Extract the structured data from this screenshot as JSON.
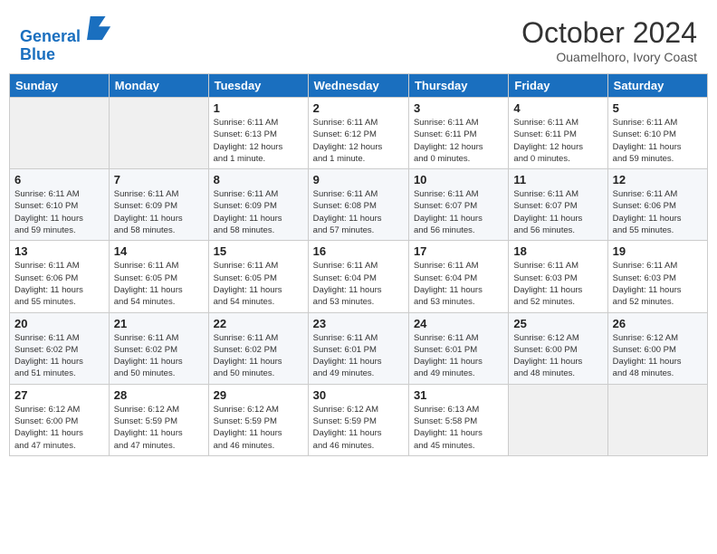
{
  "header": {
    "logo_line1": "General",
    "logo_line2": "Blue",
    "month_title": "October 2024",
    "subtitle": "Ouamelhoro, Ivory Coast"
  },
  "weekdays": [
    "Sunday",
    "Monday",
    "Tuesday",
    "Wednesday",
    "Thursday",
    "Friday",
    "Saturday"
  ],
  "weeks": [
    [
      {
        "day": "",
        "info": ""
      },
      {
        "day": "",
        "info": ""
      },
      {
        "day": "1",
        "info": "Sunrise: 6:11 AM\nSunset: 6:13 PM\nDaylight: 12 hours\nand 1 minute."
      },
      {
        "day": "2",
        "info": "Sunrise: 6:11 AM\nSunset: 6:12 PM\nDaylight: 12 hours\nand 1 minute."
      },
      {
        "day": "3",
        "info": "Sunrise: 6:11 AM\nSunset: 6:11 PM\nDaylight: 12 hours\nand 0 minutes."
      },
      {
        "day": "4",
        "info": "Sunrise: 6:11 AM\nSunset: 6:11 PM\nDaylight: 12 hours\nand 0 minutes."
      },
      {
        "day": "5",
        "info": "Sunrise: 6:11 AM\nSunset: 6:10 PM\nDaylight: 11 hours\nand 59 minutes."
      }
    ],
    [
      {
        "day": "6",
        "info": "Sunrise: 6:11 AM\nSunset: 6:10 PM\nDaylight: 11 hours\nand 59 minutes."
      },
      {
        "day": "7",
        "info": "Sunrise: 6:11 AM\nSunset: 6:09 PM\nDaylight: 11 hours\nand 58 minutes."
      },
      {
        "day": "8",
        "info": "Sunrise: 6:11 AM\nSunset: 6:09 PM\nDaylight: 11 hours\nand 58 minutes."
      },
      {
        "day": "9",
        "info": "Sunrise: 6:11 AM\nSunset: 6:08 PM\nDaylight: 11 hours\nand 57 minutes."
      },
      {
        "day": "10",
        "info": "Sunrise: 6:11 AM\nSunset: 6:07 PM\nDaylight: 11 hours\nand 56 minutes."
      },
      {
        "day": "11",
        "info": "Sunrise: 6:11 AM\nSunset: 6:07 PM\nDaylight: 11 hours\nand 56 minutes."
      },
      {
        "day": "12",
        "info": "Sunrise: 6:11 AM\nSunset: 6:06 PM\nDaylight: 11 hours\nand 55 minutes."
      }
    ],
    [
      {
        "day": "13",
        "info": "Sunrise: 6:11 AM\nSunset: 6:06 PM\nDaylight: 11 hours\nand 55 minutes."
      },
      {
        "day": "14",
        "info": "Sunrise: 6:11 AM\nSunset: 6:05 PM\nDaylight: 11 hours\nand 54 minutes."
      },
      {
        "day": "15",
        "info": "Sunrise: 6:11 AM\nSunset: 6:05 PM\nDaylight: 11 hours\nand 54 minutes."
      },
      {
        "day": "16",
        "info": "Sunrise: 6:11 AM\nSunset: 6:04 PM\nDaylight: 11 hours\nand 53 minutes."
      },
      {
        "day": "17",
        "info": "Sunrise: 6:11 AM\nSunset: 6:04 PM\nDaylight: 11 hours\nand 53 minutes."
      },
      {
        "day": "18",
        "info": "Sunrise: 6:11 AM\nSunset: 6:03 PM\nDaylight: 11 hours\nand 52 minutes."
      },
      {
        "day": "19",
        "info": "Sunrise: 6:11 AM\nSunset: 6:03 PM\nDaylight: 11 hours\nand 52 minutes."
      }
    ],
    [
      {
        "day": "20",
        "info": "Sunrise: 6:11 AM\nSunset: 6:02 PM\nDaylight: 11 hours\nand 51 minutes."
      },
      {
        "day": "21",
        "info": "Sunrise: 6:11 AM\nSunset: 6:02 PM\nDaylight: 11 hours\nand 50 minutes."
      },
      {
        "day": "22",
        "info": "Sunrise: 6:11 AM\nSunset: 6:02 PM\nDaylight: 11 hours\nand 50 minutes."
      },
      {
        "day": "23",
        "info": "Sunrise: 6:11 AM\nSunset: 6:01 PM\nDaylight: 11 hours\nand 49 minutes."
      },
      {
        "day": "24",
        "info": "Sunrise: 6:11 AM\nSunset: 6:01 PM\nDaylight: 11 hours\nand 49 minutes."
      },
      {
        "day": "25",
        "info": "Sunrise: 6:12 AM\nSunset: 6:00 PM\nDaylight: 11 hours\nand 48 minutes."
      },
      {
        "day": "26",
        "info": "Sunrise: 6:12 AM\nSunset: 6:00 PM\nDaylight: 11 hours\nand 48 minutes."
      }
    ],
    [
      {
        "day": "27",
        "info": "Sunrise: 6:12 AM\nSunset: 6:00 PM\nDaylight: 11 hours\nand 47 minutes."
      },
      {
        "day": "28",
        "info": "Sunrise: 6:12 AM\nSunset: 5:59 PM\nDaylight: 11 hours\nand 47 minutes."
      },
      {
        "day": "29",
        "info": "Sunrise: 6:12 AM\nSunset: 5:59 PM\nDaylight: 11 hours\nand 46 minutes."
      },
      {
        "day": "30",
        "info": "Sunrise: 6:12 AM\nSunset: 5:59 PM\nDaylight: 11 hours\nand 46 minutes."
      },
      {
        "day": "31",
        "info": "Sunrise: 6:13 AM\nSunset: 5:58 PM\nDaylight: 11 hours\nand 45 minutes."
      },
      {
        "day": "",
        "info": ""
      },
      {
        "day": "",
        "info": ""
      }
    ]
  ]
}
